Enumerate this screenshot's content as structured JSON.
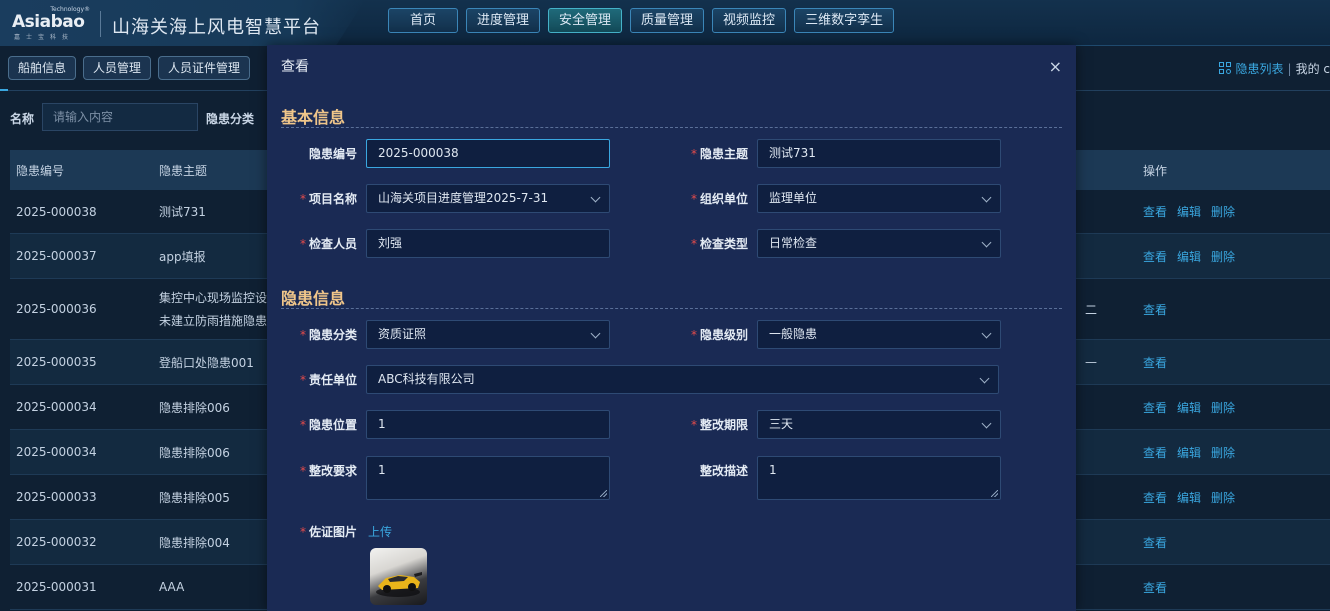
{
  "header": {
    "logo": {
      "small": "Technology®",
      "main": "Asiabao",
      "sub": "嘉士宝科技"
    },
    "title": "山海关海上风电智慧平台",
    "nav": [
      "首页",
      "进度管理",
      "安全管理",
      "质量管理",
      "视频监控",
      "三维数字孪生"
    ],
    "active_nav": "安全管理"
  },
  "subtabs": [
    "船舶信息",
    "人员管理",
    "人员证件管理"
  ],
  "right_links": {
    "list": "隐患列表",
    "sep": "|",
    "mine": "我的 c"
  },
  "filters": {
    "name_label": "名称",
    "name_placeholder": "请输入内容",
    "category_label": "隐患分类"
  },
  "table": {
    "headers": {
      "id": "隐患编号",
      "title": "隐患主题",
      "ops": "操作"
    },
    "actions": {
      "view": "查看",
      "edit": "编辑",
      "delete": "删除"
    },
    "rows": [
      {
        "id": "2025-000038",
        "title": "测试731",
        "title2": "",
        "ops": [
          "view",
          "edit",
          "delete"
        ],
        "stray": ""
      },
      {
        "id": "2025-000037",
        "title": "app填报",
        "title2": "",
        "ops": [
          "view",
          "edit",
          "delete"
        ],
        "stray": ""
      },
      {
        "id": "2025-000036",
        "title": "集控中心现场监控设",
        "title2": "未建立防雨措施隐患",
        "ops": [
          "view"
        ],
        "stray": "二"
      },
      {
        "id": "2025-000035",
        "title": "登船口处隐患001",
        "title2": "",
        "ops": [
          "view"
        ],
        "stray": "—"
      },
      {
        "id": "2025-000034",
        "title": "隐患排除006",
        "title2": "",
        "ops": [
          "view",
          "edit",
          "delete"
        ],
        "stray": ""
      },
      {
        "id": "2025-000034",
        "title": "隐患排除006",
        "title2": "",
        "ops": [
          "view",
          "edit",
          "delete"
        ],
        "stray": ""
      },
      {
        "id": "2025-000033",
        "title": "隐患排除005",
        "title2": "",
        "ops": [
          "view",
          "edit",
          "delete"
        ],
        "stray": ""
      },
      {
        "id": "2025-000032",
        "title": "隐患排除004",
        "title2": "",
        "ops": [
          "view"
        ],
        "stray": ""
      },
      {
        "id": "2025-000031",
        "title": "AAA",
        "title2": "",
        "ops": [
          "view"
        ],
        "stray": ""
      }
    ]
  },
  "modal": {
    "title": "查看",
    "close": "×",
    "section_basic": "基本信息",
    "section_hazard": "隐患信息",
    "fields": {
      "hazard_no": {
        "label": "隐患编号",
        "value": "2025-000038"
      },
      "hazard_topic": {
        "label": "隐患主题",
        "value": "测试731"
      },
      "project_name": {
        "label": "项目名称",
        "value": "山海关项目进度管理2025-7-31"
      },
      "org_unit": {
        "label": "组织单位",
        "value": "监理单位"
      },
      "inspector": {
        "label": "检查人员",
        "value": "刘强"
      },
      "inspect_type": {
        "label": "检查类型",
        "value": "日常检查"
      },
      "hazard_category": {
        "label": "隐患分类",
        "value": "资质证照"
      },
      "hazard_level": {
        "label": "隐患级别",
        "value": "一般隐患"
      },
      "responsible_unit": {
        "label": "责任单位",
        "value": "ABC科技有限公司"
      },
      "hazard_location": {
        "label": "隐患位置",
        "value": "1"
      },
      "rectify_deadline": {
        "label": "整改期限",
        "value": "三天"
      },
      "rectify_requirement": {
        "label": "整改要求",
        "value": "1"
      },
      "rectify_description": {
        "label": "整改描述",
        "value": "1"
      },
      "evidence_photo": {
        "label": "佐证图片",
        "upload": "上传"
      }
    }
  }
}
